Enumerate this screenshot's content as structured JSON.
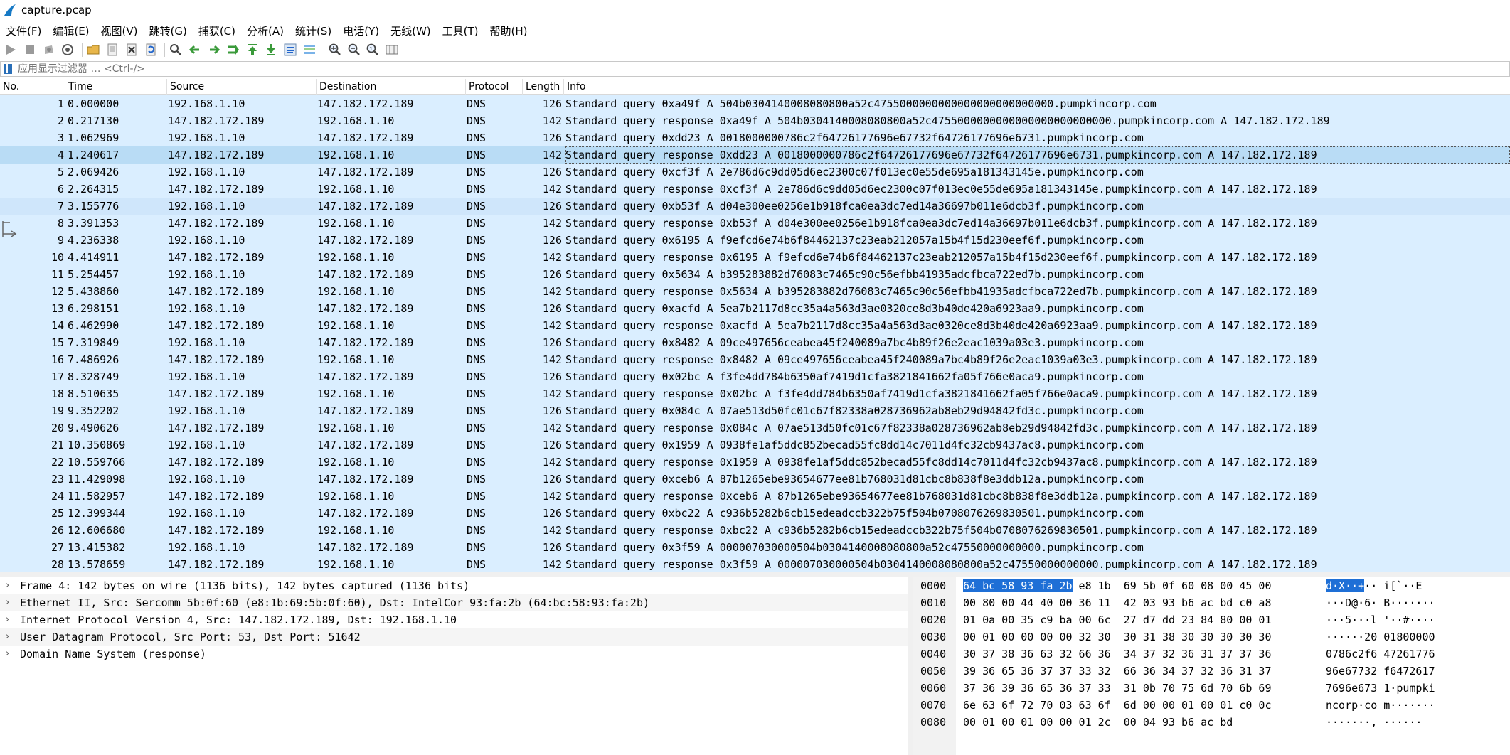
{
  "window": {
    "title": "capture.pcap"
  },
  "menu": [
    "文件(F)",
    "编辑(E)",
    "视图(V)",
    "跳转(G)",
    "捕获(C)",
    "分析(A)",
    "统计(S)",
    "电话(Y)",
    "无线(W)",
    "工具(T)",
    "帮助(H)"
  ],
  "toolbar": {
    "icons": [
      "start-capture-icon",
      "stop-capture-icon",
      "restart-capture-icon",
      "capture-options-icon",
      "open-file-icon",
      "save-file-icon",
      "close-file-icon",
      "reload-file-icon",
      "find-packet-icon",
      "go-back-icon",
      "go-forward-icon",
      "go-to-packet-icon",
      "go-first-icon",
      "go-last-icon",
      "autoscroll-icon",
      "colorize-icon",
      "zoom-in-icon",
      "zoom-out-icon",
      "zoom-reset-icon",
      "resize-columns-icon"
    ]
  },
  "filter": {
    "placeholder": "应用显示过滤器 … <Ctrl-/>"
  },
  "packet_list": {
    "columns": [
      "No.",
      "Time",
      "Source",
      "Destination",
      "Protocol",
      "Length",
      "Info"
    ],
    "selected_no": 4,
    "rows": [
      {
        "no": "1",
        "time": "0.000000",
        "src": "192.168.1.10",
        "dst": "147.182.172.189",
        "proto": "DNS",
        "len": "126",
        "info": "Standard query 0xa49f A 504b0304140008080800a52c4755000000000000000000000000.pumpkincorp.com"
      },
      {
        "no": "2",
        "time": "0.217130",
        "src": "147.182.172.189",
        "dst": "192.168.1.10",
        "proto": "DNS",
        "len": "142",
        "info": "Standard query response 0xa49f A 504b0304140008080800a52c4755000000000000000000000000.pumpkincorp.com A 147.182.172.189"
      },
      {
        "no": "3",
        "time": "1.062969",
        "src": "192.168.1.10",
        "dst": "147.182.172.189",
        "proto": "DNS",
        "len": "126",
        "info": "Standard query 0xdd23 A 0018000000786c2f64726177696e67732f64726177696e6731.pumpkincorp.com"
      },
      {
        "no": "4",
        "time": "1.240617",
        "src": "147.182.172.189",
        "dst": "192.168.1.10",
        "proto": "DNS",
        "len": "142",
        "info": "Standard query response 0xdd23 A 0018000000786c2f64726177696e67732f64726177696e6731.pumpkincorp.com A 147.182.172.189"
      },
      {
        "no": "5",
        "time": "2.069426",
        "src": "192.168.1.10",
        "dst": "147.182.172.189",
        "proto": "DNS",
        "len": "126",
        "info": "Standard query 0xcf3f A 2e786d6c9dd05d6ec2300c07f013ec0e55de695a181343145e.pumpkincorp.com"
      },
      {
        "no": "6",
        "time": "2.264315",
        "src": "147.182.172.189",
        "dst": "192.168.1.10",
        "proto": "DNS",
        "len": "142",
        "info": "Standard query response 0xcf3f A 2e786d6c9dd05d6ec2300c07f013ec0e55de695a181343145e.pumpkincorp.com A 147.182.172.189"
      },
      {
        "no": "7",
        "time": "3.155776",
        "src": "192.168.1.10",
        "dst": "147.182.172.189",
        "proto": "DNS",
        "len": "126",
        "info": "Standard query 0xb53f A d04e300ee0256e1b918fca0ea3dc7ed14a36697b011e6dcb3f.pumpkincorp.com"
      },
      {
        "no": "8",
        "time": "3.391353",
        "src": "147.182.172.189",
        "dst": "192.168.1.10",
        "proto": "DNS",
        "len": "142",
        "info": "Standard query response 0xb53f A d04e300ee0256e1b918fca0ea3dc7ed14a36697b011e6dcb3f.pumpkincorp.com A 147.182.172.189"
      },
      {
        "no": "9",
        "time": "4.236338",
        "src": "192.168.1.10",
        "dst": "147.182.172.189",
        "proto": "DNS",
        "len": "126",
        "info": "Standard query 0x6195 A f9efcd6e74b6f84462137c23eab212057a15b4f15d230eef6f.pumpkincorp.com"
      },
      {
        "no": "10",
        "time": "4.414911",
        "src": "147.182.172.189",
        "dst": "192.168.1.10",
        "proto": "DNS",
        "len": "142",
        "info": "Standard query response 0x6195 A f9efcd6e74b6f84462137c23eab212057a15b4f15d230eef6f.pumpkincorp.com A 147.182.172.189"
      },
      {
        "no": "11",
        "time": "5.254457",
        "src": "192.168.1.10",
        "dst": "147.182.172.189",
        "proto": "DNS",
        "len": "126",
        "info": "Standard query 0x5634 A b395283882d76083c7465c90c56efbb41935adcfbca722ed7b.pumpkincorp.com"
      },
      {
        "no": "12",
        "time": "5.438860",
        "src": "147.182.172.189",
        "dst": "192.168.1.10",
        "proto": "DNS",
        "len": "142",
        "info": "Standard query response 0x5634 A b395283882d76083c7465c90c56efbb41935adcfbca722ed7b.pumpkincorp.com A 147.182.172.189"
      },
      {
        "no": "13",
        "time": "6.298151",
        "src": "192.168.1.10",
        "dst": "147.182.172.189",
        "proto": "DNS",
        "len": "126",
        "info": "Standard query 0xacfd A 5ea7b2117d8cc35a4a563d3ae0320ce8d3b40de420a6923aa9.pumpkincorp.com"
      },
      {
        "no": "14",
        "time": "6.462990",
        "src": "147.182.172.189",
        "dst": "192.168.1.10",
        "proto": "DNS",
        "len": "142",
        "info": "Standard query response 0xacfd A 5ea7b2117d8cc35a4a563d3ae0320ce8d3b40de420a6923aa9.pumpkincorp.com A 147.182.172.189"
      },
      {
        "no": "15",
        "time": "7.319849",
        "src": "192.168.1.10",
        "dst": "147.182.172.189",
        "proto": "DNS",
        "len": "126",
        "info": "Standard query 0x8482 A 09ce497656ceabea45f240089a7bc4b89f26e2eac1039a03e3.pumpkincorp.com"
      },
      {
        "no": "16",
        "time": "7.486926",
        "src": "147.182.172.189",
        "dst": "192.168.1.10",
        "proto": "DNS",
        "len": "142",
        "info": "Standard query response 0x8482 A 09ce497656ceabea45f240089a7bc4b89f26e2eac1039a03e3.pumpkincorp.com A 147.182.172.189"
      },
      {
        "no": "17",
        "time": "8.328749",
        "src": "192.168.1.10",
        "dst": "147.182.172.189",
        "proto": "DNS",
        "len": "126",
        "info": "Standard query 0x02bc A f3fe4dd784b6350af7419d1cfa3821841662fa05f766e0aca9.pumpkincorp.com"
      },
      {
        "no": "18",
        "time": "8.510635",
        "src": "147.182.172.189",
        "dst": "192.168.1.10",
        "proto": "DNS",
        "len": "142",
        "info": "Standard query response 0x02bc A f3fe4dd784b6350af7419d1cfa3821841662fa05f766e0aca9.pumpkincorp.com A 147.182.172.189"
      },
      {
        "no": "19",
        "time": "9.352202",
        "src": "192.168.1.10",
        "dst": "147.182.172.189",
        "proto": "DNS",
        "len": "126",
        "info": "Standard query 0x084c A 07ae513d50fc01c67f82338a028736962ab8eb29d94842fd3c.pumpkincorp.com"
      },
      {
        "no": "20",
        "time": "9.490626",
        "src": "147.182.172.189",
        "dst": "192.168.1.10",
        "proto": "DNS",
        "len": "142",
        "info": "Standard query response 0x084c A 07ae513d50fc01c67f82338a028736962ab8eb29d94842fd3c.pumpkincorp.com A 147.182.172.189"
      },
      {
        "no": "21",
        "time": "10.350869",
        "src": "192.168.1.10",
        "dst": "147.182.172.189",
        "proto": "DNS",
        "len": "126",
        "info": "Standard query 0x1959 A 0938fe1af5ddc852becad55fc8dd14c7011d4fc32cb9437ac8.pumpkincorp.com"
      },
      {
        "no": "22",
        "time": "10.559766",
        "src": "147.182.172.189",
        "dst": "192.168.1.10",
        "proto": "DNS",
        "len": "142",
        "info": "Standard query response 0x1959 A 0938fe1af5ddc852becad55fc8dd14c7011d4fc32cb9437ac8.pumpkincorp.com A 147.182.172.189"
      },
      {
        "no": "23",
        "time": "11.429098",
        "src": "192.168.1.10",
        "dst": "147.182.172.189",
        "proto": "DNS",
        "len": "126",
        "info": "Standard query 0xceb6 A 87b1265ebe93654677ee81b768031d81cbc8b838f8e3ddb12a.pumpkincorp.com"
      },
      {
        "no": "24",
        "time": "11.582957",
        "src": "147.182.172.189",
        "dst": "192.168.1.10",
        "proto": "DNS",
        "len": "142",
        "info": "Standard query response 0xceb6 A 87b1265ebe93654677ee81b768031d81cbc8b838f8e3ddb12a.pumpkincorp.com A 147.182.172.189"
      },
      {
        "no": "25",
        "time": "12.399344",
        "src": "192.168.1.10",
        "dst": "147.182.172.189",
        "proto": "DNS",
        "len": "126",
        "info": "Standard query 0xbc22 A c936b5282b6cb15edeadccb322b75f504b0708076269830501.pumpkincorp.com"
      },
      {
        "no": "26",
        "time": "12.606680",
        "src": "147.182.172.189",
        "dst": "192.168.1.10",
        "proto": "DNS",
        "len": "142",
        "info": "Standard query response 0xbc22 A c936b5282b6cb15edeadccb322b75f504b0708076269830501.pumpkincorp.com A 147.182.172.189"
      },
      {
        "no": "27",
        "time": "13.415382",
        "src": "192.168.1.10",
        "dst": "147.182.172.189",
        "proto": "DNS",
        "len": "126",
        "info": "Standard query 0x3f59 A 000007030000504b0304140008080800a52c47550000000000.pumpkincorp.com"
      },
      {
        "no": "28",
        "time": "13.578659",
        "src": "147.182.172.189",
        "dst": "192.168.1.10",
        "proto": "DNS",
        "len": "142",
        "info": "Standard query response 0x3f59 A 000007030000504b0304140008080800a52c47550000000000.pumpkincorp.com A 147.182.172.189"
      }
    ]
  },
  "details": [
    "Frame 4: 142 bytes on wire (1136 bits), 142 bytes captured (1136 bits)",
    "Ethernet II, Src: Sercomm_5b:0f:60 (e8:1b:69:5b:0f:60), Dst: IntelCor_93:fa:2b (64:bc:58:93:fa:2b)",
    "Internet Protocol Version 4, Src: 147.182.172.189, Dst: 192.168.1.10",
    "User Datagram Protocol, Src Port: 53, Dst Port: 51642",
    "Domain Name System (response)"
  ],
  "bytes": [
    {
      "off": "0000",
      "hex_hl": "64 bc 58 93 fa 2b",
      "hex": " e8 1b  69 5b 0f 60 08 00 45 00",
      "asc_hl": "d·X··+",
      "asc": "·· i[`··E"
    },
    {
      "off": "0010",
      "hex_hl": "",
      "hex": "00 80 00 44 40 00 36 11  42 03 93 b6 ac bd c0 a8",
      "asc_hl": "",
      "asc": "···D@·6· B·······"
    },
    {
      "off": "0020",
      "hex_hl": "",
      "hex": "01 0a 00 35 c9 ba 00 6c  27 d7 dd 23 84 80 00 01",
      "asc_hl": "",
      "asc": "···5···l '··#····"
    },
    {
      "off": "0030",
      "hex_hl": "",
      "hex": "00 01 00 00 00 00 32 30  30 31 38 30 30 30 30 30",
      "asc_hl": "",
      "asc": "······20 01800000"
    },
    {
      "off": "0040",
      "hex_hl": "",
      "hex": "30 37 38 36 63 32 66 36  34 37 32 36 31 37 37 36",
      "asc_hl": "",
      "asc": "0786c2f6 47261776"
    },
    {
      "off": "0050",
      "hex_hl": "",
      "hex": "39 36 65 36 37 37 33 32  66 36 34 37 32 36 31 37",
      "asc_hl": "",
      "asc": "96e67732 f6472617"
    },
    {
      "off": "0060",
      "hex_hl": "",
      "hex": "37 36 39 36 65 36 37 33  31 0b 70 75 6d 70 6b 69",
      "asc_hl": "",
      "asc": "7696e673 1·pumpki"
    },
    {
      "off": "0070",
      "hex_hl": "",
      "hex": "6e 63 6f 72 70 03 63 6f  6d 00 00 01 00 01 c0 0c",
      "asc_hl": "",
      "asc": "ncorp·co m·······"
    },
    {
      "off": "0080",
      "hex_hl": "",
      "hex": "00 01 00 01 00 00 01 2c  00 04 93 b6 ac bd",
      "asc_hl": "",
      "asc": "·······, ······"
    }
  ],
  "colors": {
    "row_bg": "#daeeff",
    "selected_bg": "#b9dcf5",
    "highlight": "#1e6fd6"
  }
}
